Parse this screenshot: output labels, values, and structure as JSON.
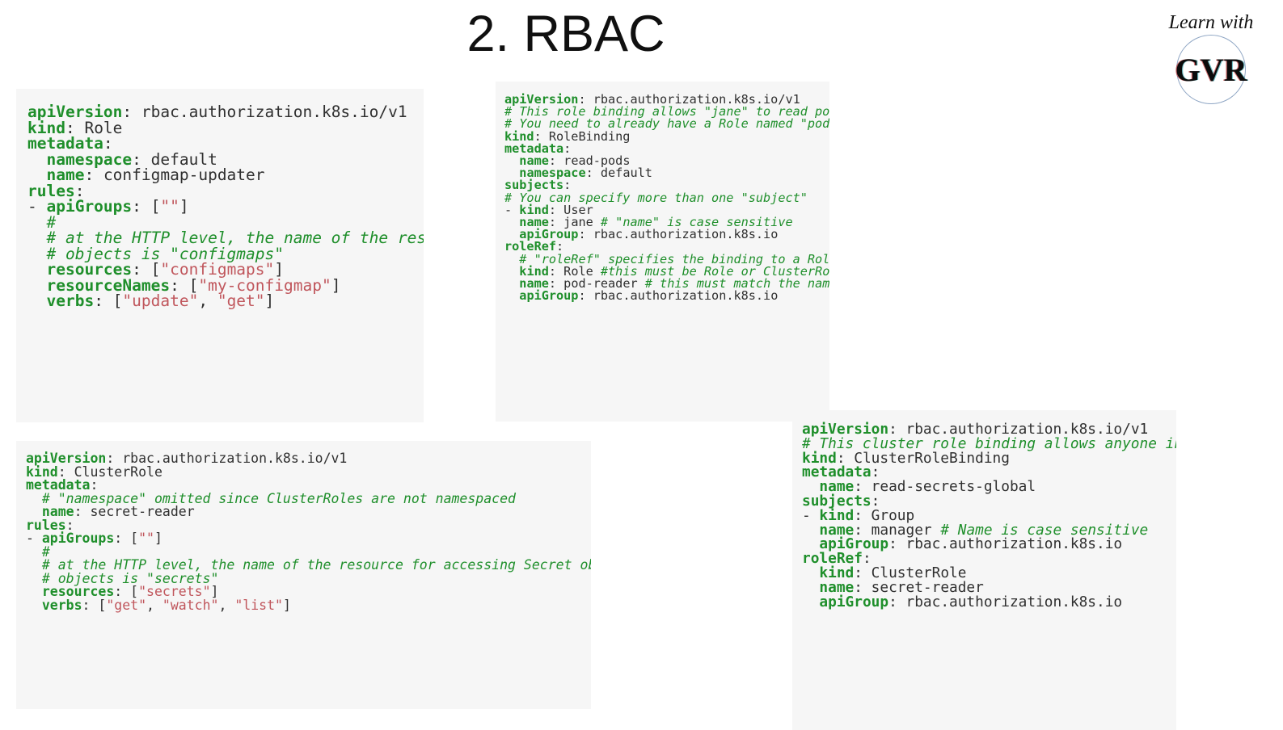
{
  "slide": {
    "title": "2. RBAC"
  },
  "logo": {
    "tagline": "Learn with",
    "mark": "GVR"
  },
  "code_blocks": [
    {
      "id": "code-role",
      "name": "role-yaml-block",
      "kind": "Role",
      "lines": [
        [
          {
            "t": "key",
            "v": "apiVersion"
          },
          {
            "t": "punc",
            "v": ": "
          },
          {
            "t": "plain",
            "v": "rbac.authorization.k8s.io/v1"
          }
        ],
        [
          {
            "t": "key",
            "v": "kind"
          },
          {
            "t": "punc",
            "v": ": "
          },
          {
            "t": "plain",
            "v": "Role"
          }
        ],
        [
          {
            "t": "key",
            "v": "metadata"
          },
          {
            "t": "punc",
            "v": ":"
          }
        ],
        [
          {
            "t": "plain",
            "v": "  "
          },
          {
            "t": "key",
            "v": "namespace"
          },
          {
            "t": "punc",
            "v": ": "
          },
          {
            "t": "plain",
            "v": "default"
          }
        ],
        [
          {
            "t": "plain",
            "v": "  "
          },
          {
            "t": "key",
            "v": "name"
          },
          {
            "t": "punc",
            "v": ": "
          },
          {
            "t": "plain",
            "v": "configmap-updater"
          }
        ],
        [
          {
            "t": "key",
            "v": "rules"
          },
          {
            "t": "punc",
            "v": ":"
          }
        ],
        [
          {
            "t": "dash",
            "v": "- "
          },
          {
            "t": "key",
            "v": "apiGroups"
          },
          {
            "t": "punc",
            "v": ": ["
          },
          {
            "t": "str",
            "v": "\"\""
          },
          {
            "t": "punc",
            "v": "]"
          }
        ],
        [
          {
            "t": "plain",
            "v": "  "
          },
          {
            "t": "cmt",
            "v": "#"
          }
        ],
        [
          {
            "t": "plain",
            "v": "  "
          },
          {
            "t": "cmt",
            "v": "# at the HTTP level, the name of the resource for accessing ConfigMap"
          }
        ],
        [
          {
            "t": "plain",
            "v": "  "
          },
          {
            "t": "cmt",
            "v": "# objects is \"configmaps\""
          }
        ],
        [
          {
            "t": "plain",
            "v": "  "
          },
          {
            "t": "key",
            "v": "resources"
          },
          {
            "t": "punc",
            "v": ": ["
          },
          {
            "t": "str",
            "v": "\"configmaps\""
          },
          {
            "t": "punc",
            "v": "]"
          }
        ],
        [
          {
            "t": "plain",
            "v": "  "
          },
          {
            "t": "key",
            "v": "resourceNames"
          },
          {
            "t": "punc",
            "v": ": ["
          },
          {
            "t": "str",
            "v": "\"my-configmap\""
          },
          {
            "t": "punc",
            "v": "]"
          }
        ],
        [
          {
            "t": "plain",
            "v": "  "
          },
          {
            "t": "key",
            "v": "verbs"
          },
          {
            "t": "punc",
            "v": ": ["
          },
          {
            "t": "str",
            "v": "\"update\""
          },
          {
            "t": "punc",
            "v": ", "
          },
          {
            "t": "str",
            "v": "\"get\""
          },
          {
            "t": "punc",
            "v": "]"
          }
        ]
      ]
    },
    {
      "id": "code-rolebinding",
      "name": "rolebinding-yaml-block",
      "kind": "RoleBinding",
      "lines": [
        [
          {
            "t": "key",
            "v": "apiVersion"
          },
          {
            "t": "punc",
            "v": ": "
          },
          {
            "t": "plain",
            "v": "rbac.authorization.k8s.io/v1"
          }
        ],
        [
          {
            "t": "cmt",
            "v": "# This role binding allows \"jane\" to read pods in the \"default\" namespace."
          }
        ],
        [
          {
            "t": "cmt",
            "v": "# You need to already have a Role named \"pod-reader\" in that namespace."
          }
        ],
        [
          {
            "t": "key",
            "v": "kind"
          },
          {
            "t": "punc",
            "v": ": "
          },
          {
            "t": "plain",
            "v": "RoleBinding"
          }
        ],
        [
          {
            "t": "key",
            "v": "metadata"
          },
          {
            "t": "punc",
            "v": ":"
          }
        ],
        [
          {
            "t": "plain",
            "v": "  "
          },
          {
            "t": "key",
            "v": "name"
          },
          {
            "t": "punc",
            "v": ": "
          },
          {
            "t": "plain",
            "v": "read-pods"
          }
        ],
        [
          {
            "t": "plain",
            "v": "  "
          },
          {
            "t": "key",
            "v": "namespace"
          },
          {
            "t": "punc",
            "v": ": "
          },
          {
            "t": "plain",
            "v": "default"
          }
        ],
        [
          {
            "t": "key",
            "v": "subjects"
          },
          {
            "t": "punc",
            "v": ":"
          }
        ],
        [
          {
            "t": "cmt",
            "v": "# You can specify more than one \"subject\""
          }
        ],
        [
          {
            "t": "dash",
            "v": "- "
          },
          {
            "t": "key",
            "v": "kind"
          },
          {
            "t": "punc",
            "v": ": "
          },
          {
            "t": "plain",
            "v": "User"
          }
        ],
        [
          {
            "t": "plain",
            "v": "  "
          },
          {
            "t": "key",
            "v": "name"
          },
          {
            "t": "punc",
            "v": ": "
          },
          {
            "t": "plain",
            "v": "jane "
          },
          {
            "t": "cmt",
            "v": "# \"name\" is case sensitive"
          }
        ],
        [
          {
            "t": "plain",
            "v": "  "
          },
          {
            "t": "key",
            "v": "apiGroup"
          },
          {
            "t": "punc",
            "v": ": "
          },
          {
            "t": "plain",
            "v": "rbac.authorization.k8s.io"
          }
        ],
        [
          {
            "t": "key",
            "v": "roleRef"
          },
          {
            "t": "punc",
            "v": ":"
          }
        ],
        [
          {
            "t": "plain",
            "v": "  "
          },
          {
            "t": "cmt",
            "v": "# \"roleRef\" specifies the binding to a Role / ClusterRole"
          }
        ],
        [
          {
            "t": "plain",
            "v": "  "
          },
          {
            "t": "key",
            "v": "kind"
          },
          {
            "t": "punc",
            "v": ": "
          },
          {
            "t": "plain",
            "v": "Role "
          },
          {
            "t": "cmt",
            "v": "#this must be Role or ClusterRole"
          }
        ],
        [
          {
            "t": "plain",
            "v": "  "
          },
          {
            "t": "key",
            "v": "name"
          },
          {
            "t": "punc",
            "v": ": "
          },
          {
            "t": "plain",
            "v": "pod-reader "
          },
          {
            "t": "cmt",
            "v": "# this must match the name of the Role"
          }
        ],
        [
          {
            "t": "plain",
            "v": "  "
          },
          {
            "t": "key",
            "v": "apiGroup"
          },
          {
            "t": "punc",
            "v": ": "
          },
          {
            "t": "plain",
            "v": "rbac.authorization.k8s.io"
          }
        ]
      ]
    },
    {
      "id": "code-clusterrole",
      "name": "clusterrole-yaml-block",
      "kind": "ClusterRole",
      "lines": [
        [
          {
            "t": "key",
            "v": "apiVersion"
          },
          {
            "t": "punc",
            "v": ": "
          },
          {
            "t": "plain",
            "v": "rbac.authorization.k8s.io/v1"
          }
        ],
        [
          {
            "t": "key",
            "v": "kind"
          },
          {
            "t": "punc",
            "v": ": "
          },
          {
            "t": "plain",
            "v": "ClusterRole"
          }
        ],
        [
          {
            "t": "key",
            "v": "metadata"
          },
          {
            "t": "punc",
            "v": ":"
          }
        ],
        [
          {
            "t": "plain",
            "v": "  "
          },
          {
            "t": "cmt",
            "v": "# \"namespace\" omitted since ClusterRoles are not namespaced"
          }
        ],
        [
          {
            "t": "plain",
            "v": "  "
          },
          {
            "t": "key",
            "v": "name"
          },
          {
            "t": "punc",
            "v": ": "
          },
          {
            "t": "plain",
            "v": "secret-reader"
          }
        ],
        [
          {
            "t": "key",
            "v": "rules"
          },
          {
            "t": "punc",
            "v": ":"
          }
        ],
        [
          {
            "t": "dash",
            "v": "- "
          },
          {
            "t": "key",
            "v": "apiGroups"
          },
          {
            "t": "punc",
            "v": ": ["
          },
          {
            "t": "str",
            "v": "\"\""
          },
          {
            "t": "punc",
            "v": "]"
          }
        ],
        [
          {
            "t": "plain",
            "v": "  "
          },
          {
            "t": "cmt",
            "v": "#"
          }
        ],
        [
          {
            "t": "plain",
            "v": "  "
          },
          {
            "t": "cmt",
            "v": "# at the HTTP level, the name of the resource for accessing Secret objects"
          }
        ],
        [
          {
            "t": "plain",
            "v": "  "
          },
          {
            "t": "cmt",
            "v": "# objects is \"secrets\""
          }
        ],
        [
          {
            "t": "plain",
            "v": "  "
          },
          {
            "t": "key",
            "v": "resources"
          },
          {
            "t": "punc",
            "v": ": ["
          },
          {
            "t": "str",
            "v": "\"secrets\""
          },
          {
            "t": "punc",
            "v": "]"
          }
        ],
        [
          {
            "t": "plain",
            "v": "  "
          },
          {
            "t": "key",
            "v": "verbs"
          },
          {
            "t": "punc",
            "v": ": ["
          },
          {
            "t": "str",
            "v": "\"get\""
          },
          {
            "t": "punc",
            "v": ", "
          },
          {
            "t": "str",
            "v": "\"watch\""
          },
          {
            "t": "punc",
            "v": ", "
          },
          {
            "t": "str",
            "v": "\"list\""
          },
          {
            "t": "punc",
            "v": "]"
          }
        ]
      ]
    },
    {
      "id": "code-clusterrolebinding",
      "name": "clusterrolebinding-yaml-block",
      "kind": "ClusterRoleBinding",
      "lines": [
        [
          {
            "t": "key",
            "v": "apiVersion"
          },
          {
            "t": "punc",
            "v": ": "
          },
          {
            "t": "plain",
            "v": "rbac.authorization.k8s.io/v1"
          }
        ],
        [
          {
            "t": "cmt",
            "v": "# This cluster role binding allows anyone in the \"manager\" group to read secrets"
          }
        ],
        [
          {
            "t": "key",
            "v": "kind"
          },
          {
            "t": "punc",
            "v": ": "
          },
          {
            "t": "plain",
            "v": "ClusterRoleBinding"
          }
        ],
        [
          {
            "t": "key",
            "v": "metadata"
          },
          {
            "t": "punc",
            "v": ":"
          }
        ],
        [
          {
            "t": "plain",
            "v": "  "
          },
          {
            "t": "key",
            "v": "name"
          },
          {
            "t": "punc",
            "v": ": "
          },
          {
            "t": "plain",
            "v": "read-secrets-global"
          }
        ],
        [
          {
            "t": "key",
            "v": "subjects"
          },
          {
            "t": "punc",
            "v": ":"
          }
        ],
        [
          {
            "t": "dash",
            "v": "- "
          },
          {
            "t": "key",
            "v": "kind"
          },
          {
            "t": "punc",
            "v": ": "
          },
          {
            "t": "plain",
            "v": "Group"
          }
        ],
        [
          {
            "t": "plain",
            "v": "  "
          },
          {
            "t": "key",
            "v": "name"
          },
          {
            "t": "punc",
            "v": ": "
          },
          {
            "t": "plain",
            "v": "manager "
          },
          {
            "t": "cmt",
            "v": "# Name is case sensitive"
          }
        ],
        [
          {
            "t": "plain",
            "v": "  "
          },
          {
            "t": "key",
            "v": "apiGroup"
          },
          {
            "t": "punc",
            "v": ": "
          },
          {
            "t": "plain",
            "v": "rbac.authorization.k8s.io"
          }
        ],
        [
          {
            "t": "key",
            "v": "roleRef"
          },
          {
            "t": "punc",
            "v": ":"
          }
        ],
        [
          {
            "t": "plain",
            "v": "  "
          },
          {
            "t": "key",
            "v": "kind"
          },
          {
            "t": "punc",
            "v": ": "
          },
          {
            "t": "plain",
            "v": "ClusterRole"
          }
        ],
        [
          {
            "t": "plain",
            "v": "  "
          },
          {
            "t": "key",
            "v": "name"
          },
          {
            "t": "punc",
            "v": ": "
          },
          {
            "t": "plain",
            "v": "secret-reader"
          }
        ],
        [
          {
            "t": "plain",
            "v": "  "
          },
          {
            "t": "key",
            "v": "apiGroup"
          },
          {
            "t": "punc",
            "v": ": "
          },
          {
            "t": "plain",
            "v": "rbac.authorization.k8s.io"
          }
        ]
      ]
    }
  ],
  "colors": {
    "background": "#ffffff",
    "code_background": "#f6f6f6",
    "key": "#1f8f2b",
    "comment": "#1f8f2b",
    "string": "#c0565c",
    "plain": "#303030",
    "title": "#101010",
    "logo_circle": "#8fa6c4"
  }
}
